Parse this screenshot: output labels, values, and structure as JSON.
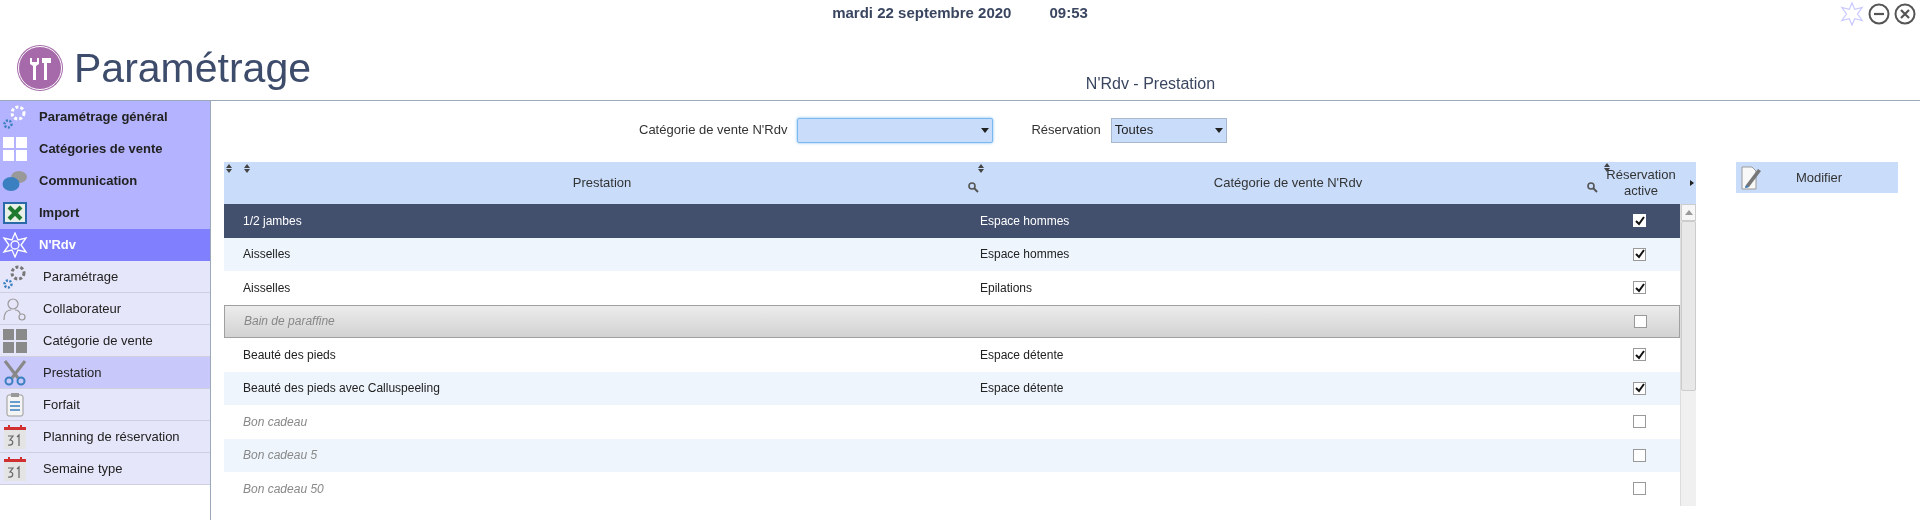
{
  "top_bar": {
    "date": "mardi 22 septembre 2020",
    "time": "09:53"
  },
  "header": {
    "title": "Paramétrage",
    "subtitle": "N'Rdv - Prestation"
  },
  "sidebar": {
    "items": [
      {
        "label": "Paramétrage général",
        "kind": "gears",
        "selected": false
      },
      {
        "label": "Catégories de vente",
        "kind": "grid",
        "selected": false
      },
      {
        "label": "Communication",
        "kind": "chat",
        "selected": false
      },
      {
        "label": "Import",
        "kind": "excel",
        "selected": false
      },
      {
        "label": "N'Rdv",
        "kind": "flower",
        "selected": true,
        "children": [
          {
            "label": "Paramétrage",
            "kind": "gears",
            "selected": false
          },
          {
            "label": "Collaborateur",
            "kind": "user",
            "selected": false
          },
          {
            "label": "Catégorie de vente",
            "kind": "grid",
            "selected": false
          },
          {
            "label": "Prestation",
            "kind": "scissors",
            "selected": true
          },
          {
            "label": "Forfait",
            "kind": "clipboard",
            "selected": false
          },
          {
            "label": "Planning de réservation",
            "kind": "calendar",
            "selected": false
          },
          {
            "label": "Semaine type",
            "kind": "calendar",
            "selected": false
          }
        ]
      }
    ]
  },
  "filters": [
    {
      "label": "Catégorie de vente N'Rdv",
      "focused": true
    },
    {
      "label": "Réservation",
      "value": "Toutes",
      "focused": false
    }
  ],
  "table": {
    "columns": [
      "Prestation",
      "Catégorie de vente N'Rdv",
      "Réservation active"
    ],
    "rows": [
      {
        "prestation": "1/2 jambes",
        "category": "Espace hommes",
        "checked": true,
        "selected": true,
        "highlighted": false
      },
      {
        "prestation": "Aisselles",
        "category": "Espace hommes",
        "checked": true,
        "selected": false,
        "highlighted": false
      },
      {
        "prestation": "Aisselles",
        "category": "Epilations",
        "checked": true,
        "selected": false,
        "highlighted": false
      },
      {
        "prestation": "Bain de paraffine",
        "checked": false,
        "selected": false,
        "highlighted": true
      },
      {
        "prestation": "Beauté des pieds",
        "category": "Espace détente",
        "checked": true,
        "selected": false,
        "highlighted": false
      },
      {
        "prestation": "Beauté des pieds avec Calluspeeling",
        "category": "Espace détente",
        "checked": true,
        "selected": false,
        "highlighted": false
      },
      {
        "prestation": "Bon cadeau",
        "checked": false,
        "selected": false,
        "highlighted": false
      },
      {
        "prestation": "Bon cadeau 5",
        "checked": false,
        "selected": false,
        "highlighted": false
      },
      {
        "prestation": "Bon cadeau 50",
        "checked": false,
        "selected": false,
        "highlighted": false
      }
    ]
  },
  "actions": [
    {
      "label": "Modifier"
    }
  ]
}
